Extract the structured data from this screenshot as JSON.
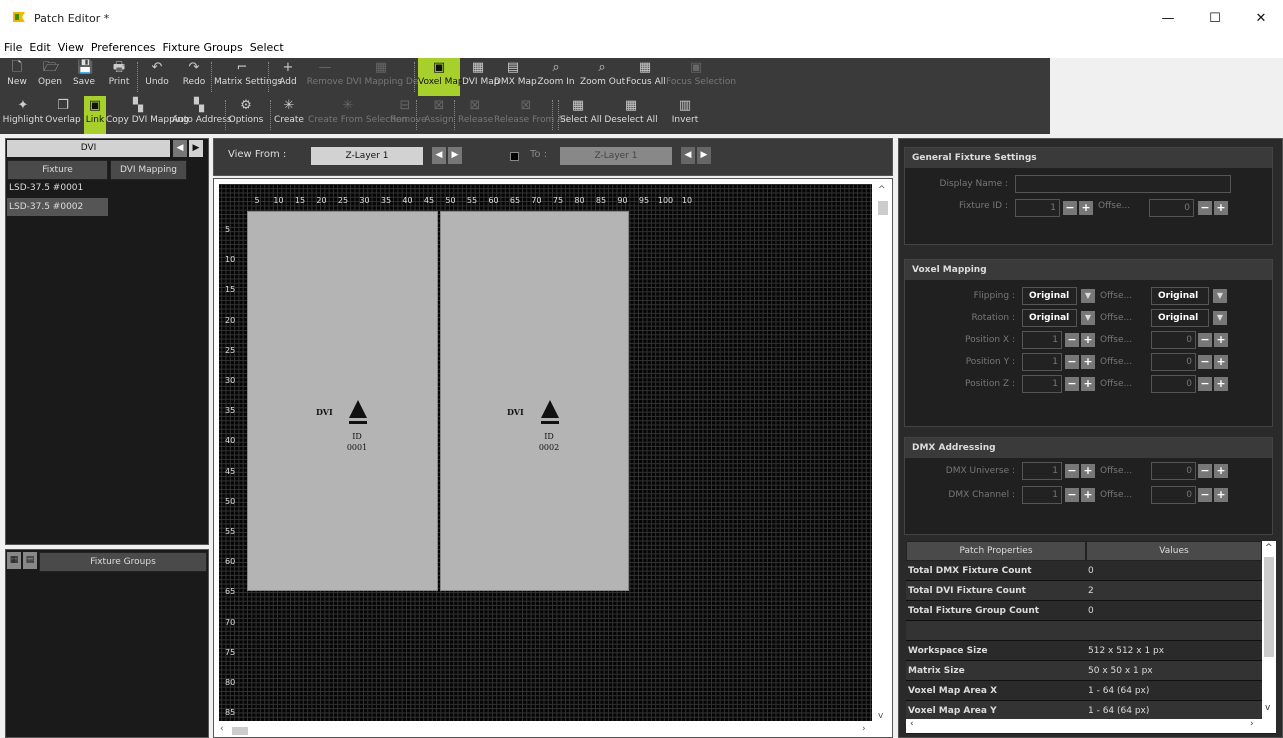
{
  "window": {
    "title": "Patch Editor *",
    "minimize": "—",
    "maximize": "☐",
    "close": "✕"
  },
  "menu": [
    "File",
    "Edit",
    "View",
    "Preferences",
    "Fixture Groups",
    "Select"
  ],
  "toolbar_row1": [
    {
      "label": "New",
      "icon": "new-file-icon",
      "glyph": "🗋",
      "state": "normal"
    },
    {
      "label": "Open",
      "icon": "open-folder-icon",
      "glyph": "🗁",
      "state": "normal"
    },
    {
      "label": "Save",
      "icon": "save-icon",
      "glyph": "💾",
      "state": "normal"
    },
    {
      "label": "Print",
      "icon": "print-icon",
      "glyph": "🖶",
      "state": "normal"
    },
    {
      "label": "Undo",
      "icon": "undo-icon",
      "glyph": "↶",
      "state": "normal"
    },
    {
      "label": "Redo",
      "icon": "redo-icon",
      "glyph": "↷",
      "state": "normal"
    },
    {
      "label": "Matrix Settings",
      "icon": "matrix-settings-icon",
      "glyph": "⌐",
      "state": "normal"
    },
    {
      "label": "Add",
      "icon": "add-icon",
      "glyph": "+",
      "state": "normal"
    },
    {
      "label": "Remove",
      "icon": "remove-icon",
      "glyph": "—",
      "state": "disabled"
    },
    {
      "label": "DVI Mapping Defaults",
      "icon": "dvi-defaults-icon",
      "glyph": "▦",
      "state": "disabled"
    },
    {
      "label": "Voxel Map",
      "icon": "voxel-map-icon",
      "glyph": "▣",
      "state": "active"
    },
    {
      "label": "DVI Map",
      "icon": "dvi-map-icon",
      "glyph": "▦",
      "state": "normal"
    },
    {
      "label": "DMX Map",
      "icon": "dmx-map-icon",
      "glyph": "▤",
      "state": "normal"
    },
    {
      "label": "Zoom In",
      "icon": "zoom-in-icon",
      "glyph": "⌕",
      "state": "normal"
    },
    {
      "label": "Zoom Out",
      "icon": "zoom-out-icon",
      "glyph": "⌕",
      "state": "normal"
    },
    {
      "label": "Focus All",
      "icon": "focus-all-icon",
      "glyph": "▦",
      "state": "normal"
    },
    {
      "label": "Focus Selection",
      "icon": "focus-selection-icon",
      "glyph": "▣",
      "state": "disabled"
    }
  ],
  "toolbar_row2": [
    {
      "label": "Highlight",
      "icon": "highlight-icon",
      "glyph": "✦",
      "state": "normal"
    },
    {
      "label": "Overlap",
      "icon": "overlap-icon",
      "glyph": "❐",
      "state": "normal"
    },
    {
      "label": "Link",
      "icon": "link-icon",
      "glyph": "▣",
      "state": "active"
    },
    {
      "label": "Copy DVI Mapping",
      "icon": "copy-dvi-icon",
      "glyph": "▚",
      "state": "normal"
    },
    {
      "label": "Auto Address",
      "icon": "auto-address-icon",
      "glyph": "▚",
      "state": "normal"
    },
    {
      "label": "Options",
      "icon": "options-gear-icon",
      "glyph": "⚙",
      "state": "normal"
    },
    {
      "label": "Create",
      "icon": "create-icon",
      "glyph": "✳",
      "state": "normal"
    },
    {
      "label": "Create From Selection",
      "icon": "create-from-selection-icon",
      "glyph": "✳",
      "state": "disabled"
    },
    {
      "label": "Remove",
      "icon": "remove-group-icon",
      "glyph": "⊟",
      "state": "disabled"
    },
    {
      "label": "Assign",
      "icon": "assign-icon",
      "glyph": "⊠",
      "state": "disabled"
    },
    {
      "label": "Release",
      "icon": "release-icon",
      "glyph": "⊠",
      "state": "disabled"
    },
    {
      "label": "Release From All",
      "icon": "release-all-icon",
      "glyph": "⊠",
      "state": "disabled"
    },
    {
      "label": "Select All",
      "icon": "select-all-icon",
      "glyph": "▦",
      "state": "normal"
    },
    {
      "label": "Deselect All",
      "icon": "deselect-all-icon",
      "glyph": "▦",
      "state": "normal"
    },
    {
      "label": "Invert",
      "icon": "invert-icon",
      "glyph": "▥",
      "state": "normal"
    }
  ],
  "left_panel": {
    "tab": "DVI",
    "columns": [
      "Fixture",
      "DVI Mapping"
    ],
    "rows": [
      {
        "fixture": "LSD-37.5 #0001",
        "mapping": ""
      },
      {
        "fixture": "LSD-37.5 #0002",
        "mapping": ""
      }
    ]
  },
  "fixture_groups": {
    "title": "Fixture Groups"
  },
  "view_bar": {
    "view_from_label": "View From :",
    "view_from": "Z-Layer 1",
    "to_label": "To :",
    "to": "Z-Layer 1"
  },
  "canvas": {
    "ruler_x": [
      "5",
      "10",
      "15",
      "20",
      "25",
      "30",
      "35",
      "40",
      "45",
      "50",
      "55",
      "60",
      "65",
      "70",
      "75",
      "80",
      "85",
      "90",
      "95",
      "100",
      "10"
    ],
    "ruler_y": [
      "5",
      "10",
      "15",
      "20",
      "25",
      "30",
      "35",
      "40",
      "45",
      "50",
      "55",
      "60",
      "65",
      "70",
      "75",
      "80",
      "85"
    ],
    "fixtures": [
      {
        "type": "DVI",
        "id_label": "ID",
        "id": "0001"
      },
      {
        "type": "DVI",
        "id_label": "ID",
        "id": "0002"
      }
    ]
  },
  "general": {
    "title": "General Fixture Settings",
    "display_name_label": "Display Name :",
    "display_name": "",
    "fixture_id_label": "Fixture ID :",
    "fixture_id": "1",
    "offset_label": "Offse...",
    "offset": "0"
  },
  "voxel": {
    "title": "Voxel Mapping",
    "flipping_label": "Flipping :",
    "flipping": "Original",
    "flipping_offset": "Original",
    "rotation_label": "Rotation :",
    "rotation": "Original",
    "rotation_offset": "Original",
    "pos_x_label": "Position X :",
    "pos_x": "1",
    "pos_x_offset": "0",
    "pos_y_label": "Position Y :",
    "pos_y": "1",
    "pos_y_offset": "0",
    "pos_z_label": "Position Z :",
    "pos_z": "1",
    "pos_z_offset": "0",
    "offset_label": "Offse..."
  },
  "dmx": {
    "title": "DMX Addressing",
    "universe_label": "DMX Universe :",
    "universe": "1",
    "universe_offset": "0",
    "channel_label": "DMX Channel :",
    "channel": "1",
    "channel_offset": "0",
    "offset_label": "Offse..."
  },
  "properties": {
    "col_key": "Patch Properties",
    "col_value": "Values",
    "rows": [
      {
        "k": "Total DMX Fixture Count",
        "v": "0"
      },
      {
        "k": "Total DVI Fixture Count",
        "v": "2"
      },
      {
        "k": "Total Fixture Group Count",
        "v": "0"
      },
      {
        "k": "",
        "v": ""
      },
      {
        "k": "Workspace Size",
        "v": "512 x 512 x 1 px"
      },
      {
        "k": "Matrix Size",
        "v": "50 x 50 x 1 px"
      },
      {
        "k": "Voxel Map Area X",
        "v": "1 - 64 (64 px)"
      },
      {
        "k": "Voxel Map Area Y",
        "v": "1 - 64 (64 px)"
      }
    ]
  },
  "colors": {
    "accent": "#a8d02c",
    "panel": "#1a1a1a",
    "toolbar": "#3a3a3a"
  }
}
